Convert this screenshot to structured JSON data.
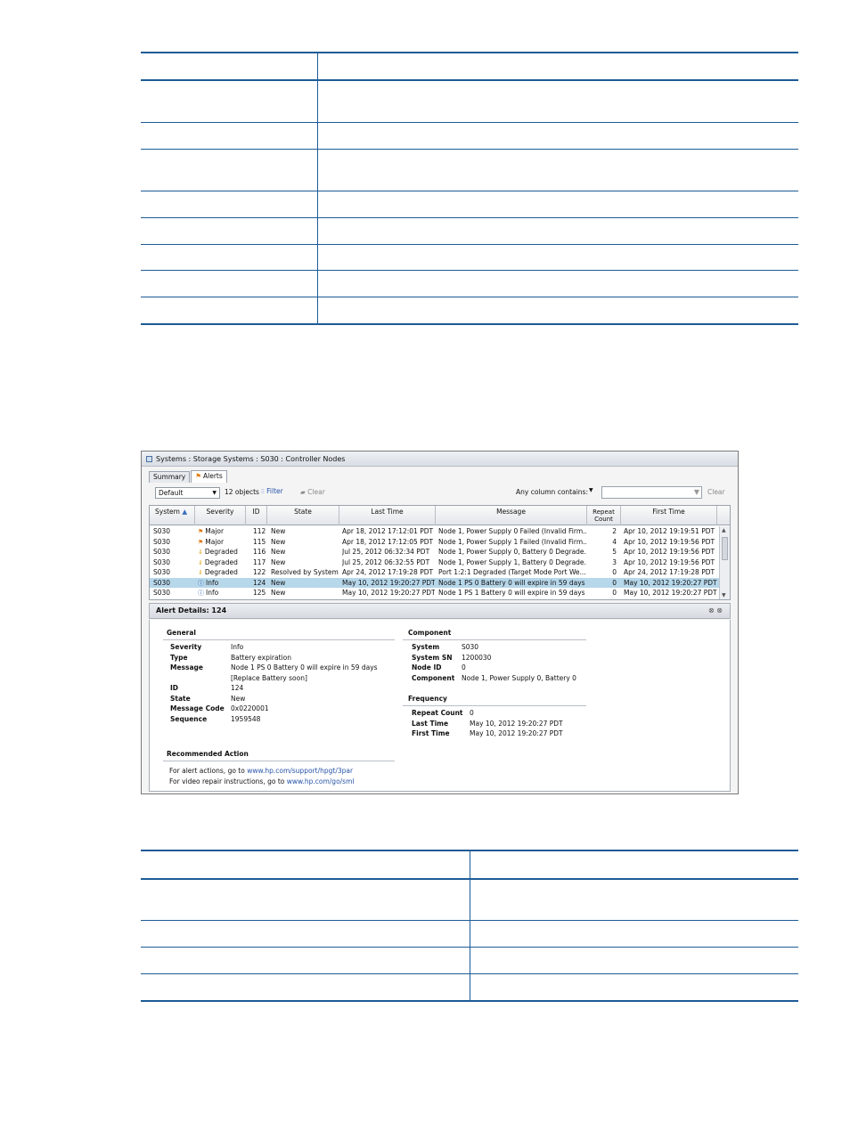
{
  "window": {
    "breadcrumb": "Systems : Storage Systems : S030 : Controller Nodes",
    "tabs": [
      {
        "label": "Summary"
      },
      {
        "label": "Alerts"
      }
    ]
  },
  "toolbar": {
    "filter_select": "Default",
    "object_count": "12 objects",
    "filter_label": "Filter",
    "clear_label": "Clear",
    "column_filter_label": "Any column contains:",
    "search_value": "",
    "search_clear_label": "Clear"
  },
  "grid": {
    "columns": [
      "System",
      "Severity",
      "ID",
      "State",
      "Last Time",
      "Message",
      "Repeat Count",
      "First Time"
    ],
    "rows": [
      {
        "system": "S030",
        "severity": "Major",
        "icon": "flag-icon",
        "id": "112",
        "state": "New",
        "last_time": "Apr 18, 2012 17:12:01 PDT",
        "message": "Node 1, Power Supply 0 Failed (Invalid Firm...",
        "repeat": "2",
        "first_time": "Apr 10, 2012 19:19:51 PDT"
      },
      {
        "system": "S030",
        "severity": "Major",
        "icon": "flag-icon",
        "id": "115",
        "state": "New",
        "last_time": "Apr 18, 2012 17:12:05 PDT",
        "message": "Node 1, Power Supply 1 Failed (Invalid Firm...",
        "repeat": "4",
        "first_time": "Apr 10, 2012 19:19:56 PDT"
      },
      {
        "system": "S030",
        "severity": "Degraded",
        "icon": "arrow-down-icon",
        "id": "116",
        "state": "New",
        "last_time": "Jul 25, 2012 06:32:34 PDT",
        "message": "Node 1, Power Supply 0, Battery 0 Degrade...",
        "repeat": "5",
        "first_time": "Apr 10, 2012 19:19:56 PDT"
      },
      {
        "system": "S030",
        "severity": "Degraded",
        "icon": "arrow-down-icon",
        "id": "117",
        "state": "New",
        "last_time": "Jul 25, 2012 06:32:55 PDT",
        "message": "Node 1, Power Supply 1, Battery 0 Degrade...",
        "repeat": "3",
        "first_time": "Apr 10, 2012 19:19:56 PDT"
      },
      {
        "system": "S030",
        "severity": "Degraded",
        "icon": "arrow-down-icon",
        "id": "122",
        "state": "Resolved by System",
        "last_time": "Apr 24, 2012 17:19:28 PDT",
        "message": "Port 1:2:1 Degraded (Target Mode Port We...",
        "repeat": "0",
        "first_time": "Apr 24, 2012 17:19:28 PDT"
      },
      {
        "system": "S030",
        "severity": "Info",
        "icon": "info-icon",
        "id": "124",
        "state": "New",
        "last_time": "May 10, 2012 19:20:27 PDT",
        "message": "Node 1 PS 0 Battery 0 will expire in 59 days ...",
        "repeat": "0",
        "first_time": "May 10, 2012 19:20:27 PDT",
        "selected": true
      },
      {
        "system": "S030",
        "severity": "Info",
        "icon": "info-icon",
        "id": "125",
        "state": "New",
        "last_time": "May 10, 2012 19:20:27 PDT",
        "message": "Node 1 PS 1 Battery 0 will expire in 59 days ...",
        "repeat": "0",
        "first_time": "May 10, 2012 19:20:27 PDT"
      }
    ]
  },
  "details": {
    "title": "Alert Details: 124",
    "general": {
      "heading": "General",
      "items": [
        {
          "k": "Severity",
          "v": "Info"
        },
        {
          "k": "Type",
          "v": "Battery expiration"
        },
        {
          "k": "Message",
          "v": "Node 1 PS 0 Battery 0 will expire in 59 days",
          "v2": "[Replace Battery soon]"
        },
        {
          "k": "ID",
          "v": "124"
        },
        {
          "k": "State",
          "v": "New"
        },
        {
          "k": "Message Code",
          "v": "0x0220001"
        },
        {
          "k": "Sequence",
          "v": "1959548"
        }
      ]
    },
    "component": {
      "heading": "Component",
      "items": [
        {
          "k": "System",
          "v": "S030"
        },
        {
          "k": "System SN",
          "v": "1200030"
        },
        {
          "k": "Node ID",
          "v": "0"
        },
        {
          "k": "Component",
          "v": "Node 1, Power Supply 0, Battery 0"
        }
      ]
    },
    "frequency": {
      "heading": "Frequency",
      "items": [
        {
          "k": "Repeat Count",
          "v": "0"
        },
        {
          "k": "Last Time",
          "v": "May 10, 2012 19:20:27 PDT"
        },
        {
          "k": "First Time",
          "v": "May 10, 2012 19:20:27 PDT"
        }
      ]
    },
    "recommended": {
      "heading": "Recommended Action",
      "line1_prefix": "For alert actions, go to",
      "line1_link": "www.hp.com/support/hpgt/3par",
      "line2_prefix": "For video repair instructions, go to",
      "line2_link": "www.hp.com/go/sml"
    }
  }
}
